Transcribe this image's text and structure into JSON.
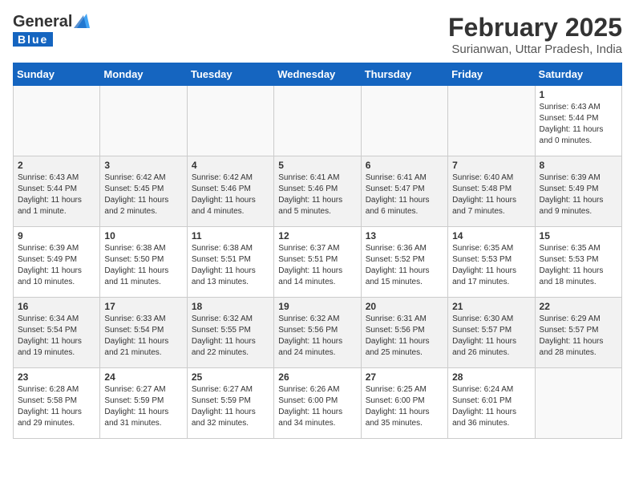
{
  "header": {
    "logo_general": "General",
    "logo_blue": "Blue",
    "month_year": "February 2025",
    "location": "Surianwan, Uttar Pradesh, India"
  },
  "days_of_week": [
    "Sunday",
    "Monday",
    "Tuesday",
    "Wednesday",
    "Thursday",
    "Friday",
    "Saturday"
  ],
  "weeks": [
    [
      {
        "day": "",
        "info": ""
      },
      {
        "day": "",
        "info": ""
      },
      {
        "day": "",
        "info": ""
      },
      {
        "day": "",
        "info": ""
      },
      {
        "day": "",
        "info": ""
      },
      {
        "day": "",
        "info": ""
      },
      {
        "day": "1",
        "info": "Sunrise: 6:43 AM\nSunset: 5:44 PM\nDaylight: 11 hours\nand 0 minutes."
      }
    ],
    [
      {
        "day": "2",
        "info": "Sunrise: 6:43 AM\nSunset: 5:44 PM\nDaylight: 11 hours\nand 1 minute."
      },
      {
        "day": "3",
        "info": "Sunrise: 6:42 AM\nSunset: 5:45 PM\nDaylight: 11 hours\nand 2 minutes."
      },
      {
        "day": "4",
        "info": "Sunrise: 6:42 AM\nSunset: 5:46 PM\nDaylight: 11 hours\nand 4 minutes."
      },
      {
        "day": "5",
        "info": "Sunrise: 6:41 AM\nSunset: 5:46 PM\nDaylight: 11 hours\nand 5 minutes."
      },
      {
        "day": "6",
        "info": "Sunrise: 6:41 AM\nSunset: 5:47 PM\nDaylight: 11 hours\nand 6 minutes."
      },
      {
        "day": "7",
        "info": "Sunrise: 6:40 AM\nSunset: 5:48 PM\nDaylight: 11 hours\nand 7 minutes."
      },
      {
        "day": "8",
        "info": "Sunrise: 6:39 AM\nSunset: 5:49 PM\nDaylight: 11 hours\nand 9 minutes."
      }
    ],
    [
      {
        "day": "9",
        "info": "Sunrise: 6:39 AM\nSunset: 5:49 PM\nDaylight: 11 hours\nand 10 minutes."
      },
      {
        "day": "10",
        "info": "Sunrise: 6:38 AM\nSunset: 5:50 PM\nDaylight: 11 hours\nand 11 minutes."
      },
      {
        "day": "11",
        "info": "Sunrise: 6:38 AM\nSunset: 5:51 PM\nDaylight: 11 hours\nand 13 minutes."
      },
      {
        "day": "12",
        "info": "Sunrise: 6:37 AM\nSunset: 5:51 PM\nDaylight: 11 hours\nand 14 minutes."
      },
      {
        "day": "13",
        "info": "Sunrise: 6:36 AM\nSunset: 5:52 PM\nDaylight: 11 hours\nand 15 minutes."
      },
      {
        "day": "14",
        "info": "Sunrise: 6:35 AM\nSunset: 5:53 PM\nDaylight: 11 hours\nand 17 minutes."
      },
      {
        "day": "15",
        "info": "Sunrise: 6:35 AM\nSunset: 5:53 PM\nDaylight: 11 hours\nand 18 minutes."
      }
    ],
    [
      {
        "day": "16",
        "info": "Sunrise: 6:34 AM\nSunset: 5:54 PM\nDaylight: 11 hours\nand 19 minutes."
      },
      {
        "day": "17",
        "info": "Sunrise: 6:33 AM\nSunset: 5:54 PM\nDaylight: 11 hours\nand 21 minutes."
      },
      {
        "day": "18",
        "info": "Sunrise: 6:32 AM\nSunset: 5:55 PM\nDaylight: 11 hours\nand 22 minutes."
      },
      {
        "day": "19",
        "info": "Sunrise: 6:32 AM\nSunset: 5:56 PM\nDaylight: 11 hours\nand 24 minutes."
      },
      {
        "day": "20",
        "info": "Sunrise: 6:31 AM\nSunset: 5:56 PM\nDaylight: 11 hours\nand 25 minutes."
      },
      {
        "day": "21",
        "info": "Sunrise: 6:30 AM\nSunset: 5:57 PM\nDaylight: 11 hours\nand 26 minutes."
      },
      {
        "day": "22",
        "info": "Sunrise: 6:29 AM\nSunset: 5:57 PM\nDaylight: 11 hours\nand 28 minutes."
      }
    ],
    [
      {
        "day": "23",
        "info": "Sunrise: 6:28 AM\nSunset: 5:58 PM\nDaylight: 11 hours\nand 29 minutes."
      },
      {
        "day": "24",
        "info": "Sunrise: 6:27 AM\nSunset: 5:59 PM\nDaylight: 11 hours\nand 31 minutes."
      },
      {
        "day": "25",
        "info": "Sunrise: 6:27 AM\nSunset: 5:59 PM\nDaylight: 11 hours\nand 32 minutes."
      },
      {
        "day": "26",
        "info": "Sunrise: 6:26 AM\nSunset: 6:00 PM\nDaylight: 11 hours\nand 34 minutes."
      },
      {
        "day": "27",
        "info": "Sunrise: 6:25 AM\nSunset: 6:00 PM\nDaylight: 11 hours\nand 35 minutes."
      },
      {
        "day": "28",
        "info": "Sunrise: 6:24 AM\nSunset: 6:01 PM\nDaylight: 11 hours\nand 36 minutes."
      },
      {
        "day": "",
        "info": ""
      }
    ]
  ]
}
